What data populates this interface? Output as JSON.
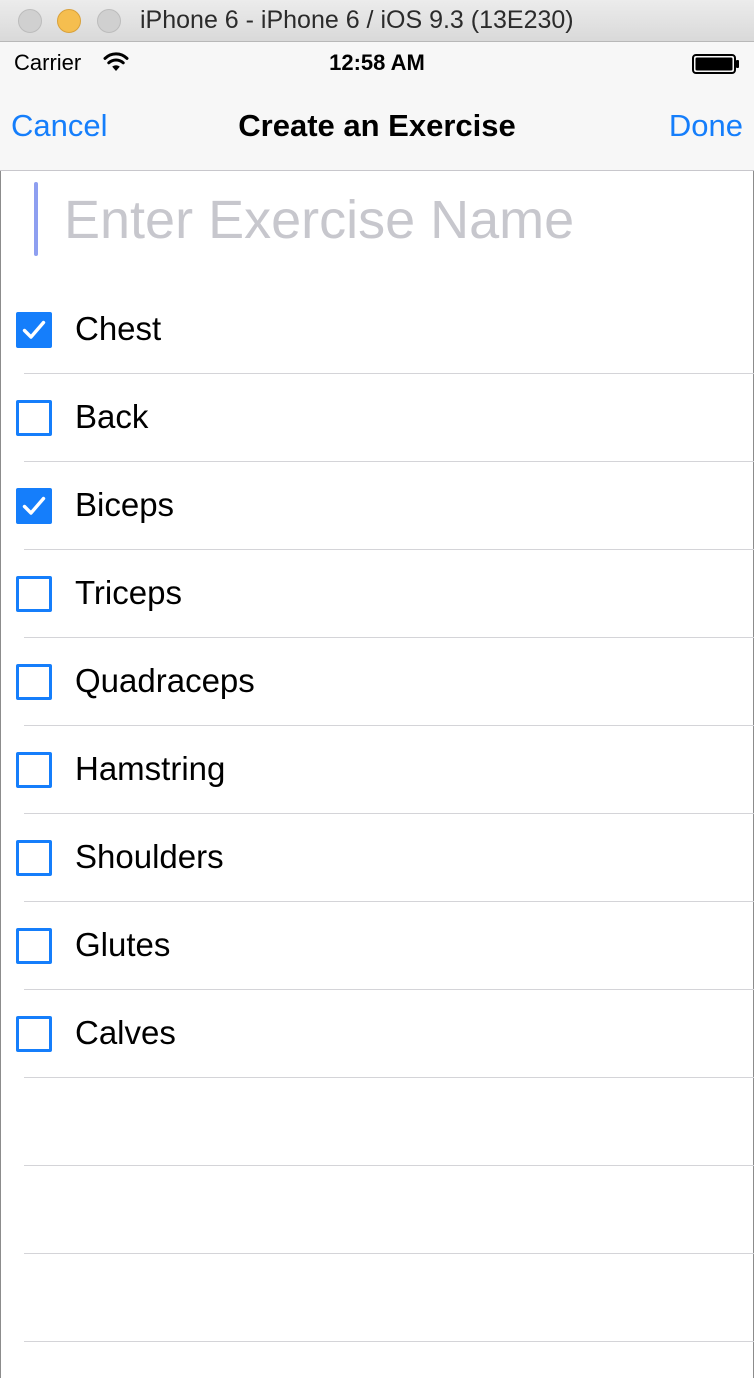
{
  "window": {
    "title": "iPhone 6 - iPhone 6 / iOS 9.3 (13E230)"
  },
  "status_bar": {
    "carrier": "Carrier",
    "time": "12:58 AM",
    "wifi_icon": "wifi-icon",
    "battery_icon": "battery-icon"
  },
  "nav": {
    "cancel_label": "Cancel",
    "title": "Create an Exercise",
    "done_label": "Done"
  },
  "exercise_name": {
    "value": "",
    "placeholder": "Enter Exercise Name"
  },
  "muscle_groups": [
    {
      "label": "Chest",
      "checked": true
    },
    {
      "label": "Back",
      "checked": false
    },
    {
      "label": "Biceps",
      "checked": true
    },
    {
      "label": "Triceps",
      "checked": false
    },
    {
      "label": "Quadraceps",
      "checked": false
    },
    {
      "label": "Hamstring",
      "checked": false
    },
    {
      "label": "Shoulders",
      "checked": false
    },
    {
      "label": "Glutes",
      "checked": false
    },
    {
      "label": "Calves",
      "checked": false
    }
  ],
  "colors": {
    "accent": "#157efb",
    "separator": "#d4d4d8",
    "placeholder": "#c7c7cd"
  }
}
